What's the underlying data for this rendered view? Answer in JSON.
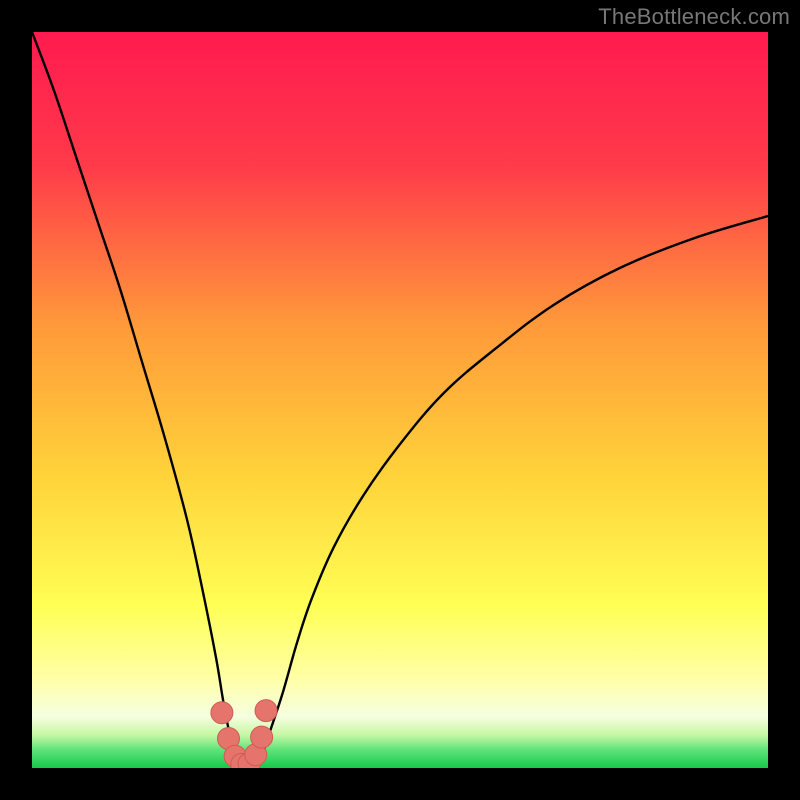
{
  "watermark": "TheBottleneck.com",
  "colors": {
    "bg_black": "#000000",
    "grad_top": "#ff1a4f",
    "grad_mid_upper": "#ff7a3a",
    "grad_mid": "#ffd23a",
    "grad_lower_yellow": "#ffff66",
    "grad_pale": "#fcffe0",
    "grad_green": "#1bd84f",
    "curve": "#000000",
    "marker_fill": "#e5756c",
    "marker_stroke": "#d25a52"
  },
  "chart_data": {
    "type": "line",
    "title": "",
    "xlabel": "",
    "ylabel": "",
    "xlim": [
      0,
      100
    ],
    "ylim": [
      0,
      100
    ],
    "notes": "Background is a vertical gradient red→orange→yellow→pale→green. No numeric axes, ticks, or legend are rendered. A black V-shaped curve descends from the top-left almost vertically, reaches ~0 near x≈27, stays near zero until x≈31, then rises with decreasing slope to the right edge at y≈75. Salmon-colored marker dots sit along the trough.",
    "series": [
      {
        "name": "bottleneck-curve",
        "x": [
          0,
          3,
          6,
          9,
          12,
          15,
          18,
          21,
          23,
          25,
          26,
          27,
          28,
          29,
          30,
          31,
          32,
          34,
          36,
          38,
          41,
          45,
          50,
          56,
          63,
          71,
          80,
          90,
          100
        ],
        "y": [
          100,
          92,
          83,
          74,
          65,
          55,
          45,
          34,
          25,
          15,
          9,
          4,
          1,
          0,
          0,
          1,
          4,
          10,
          17,
          23,
          30,
          37,
          44,
          51,
          57,
          63,
          68,
          72,
          75
        ]
      }
    ],
    "markers": {
      "name": "trough-markers",
      "x": [
        25.8,
        26.7,
        27.6,
        28.5,
        29.5,
        30.4,
        31.2,
        31.8
      ],
      "y": [
        7.5,
        4.0,
        1.6,
        0.5,
        0.6,
        1.8,
        4.2,
        7.8
      ]
    },
    "gradient_stops": [
      {
        "offset": 0.0,
        "color": "#ff1a4f"
      },
      {
        "offset": 0.18,
        "color": "#ff3a4a"
      },
      {
        "offset": 0.4,
        "color": "#ff9a3a"
      },
      {
        "offset": 0.6,
        "color": "#ffd23a"
      },
      {
        "offset": 0.78,
        "color": "#ffff55"
      },
      {
        "offset": 0.88,
        "color": "#ffffa8"
      },
      {
        "offset": 0.93,
        "color": "#f6ffe0"
      },
      {
        "offset": 0.955,
        "color": "#c6f7a4"
      },
      {
        "offset": 0.975,
        "color": "#5fe47a"
      },
      {
        "offset": 1.0,
        "color": "#17c94a"
      }
    ]
  }
}
